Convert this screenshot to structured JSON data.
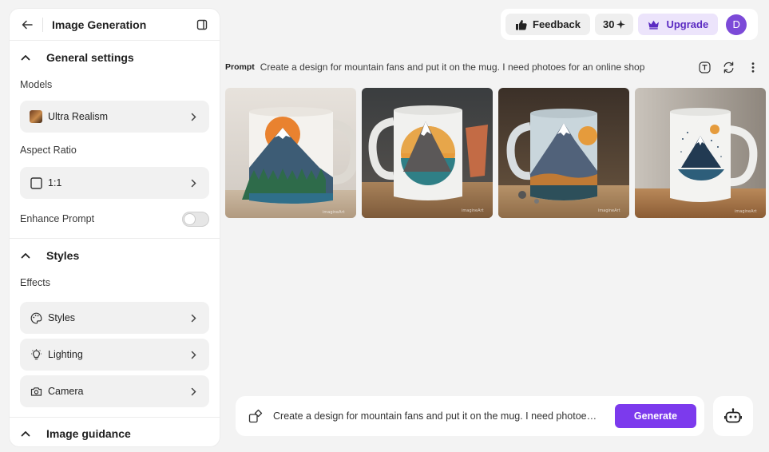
{
  "sidebar": {
    "title": "Image Generation",
    "general": {
      "heading": "General settings",
      "models_label": "Models",
      "model_value": "Ultra Realism",
      "aspect_label": "Aspect Ratio",
      "aspect_value": "1:1",
      "enhance_label": "Enhance Prompt",
      "enhance_on": false
    },
    "styles": {
      "heading": "Styles",
      "effects_label": "Effects",
      "items": [
        {
          "label": "Styles",
          "icon": "palette-icon"
        },
        {
          "label": "Lighting",
          "icon": "lightbulb-icon"
        },
        {
          "label": "Camera",
          "icon": "camera-icon"
        }
      ]
    },
    "next_section": "Image guidance"
  },
  "topbar": {
    "feedback": "Feedback",
    "credits": "30",
    "upgrade": "Upgrade",
    "avatar_initial": "D"
  },
  "prompt": {
    "label": "Prompt",
    "text": "Create a design for mountain fans and put it on the mug. I need photoes for an online shop"
  },
  "results": [
    {
      "name": "mug-result-1"
    },
    {
      "name": "mug-result-2"
    },
    {
      "name": "mug-result-3"
    },
    {
      "name": "mug-result-4"
    }
  ],
  "composer": {
    "text": "Create a design for mountain fans and put it on the mug. I need photoes for an online shop",
    "generate": "Generate"
  },
  "colors": {
    "accent": "#7c3aed",
    "upgrade_bg": "#ece4fb",
    "avatar": "#7c4ad8"
  }
}
